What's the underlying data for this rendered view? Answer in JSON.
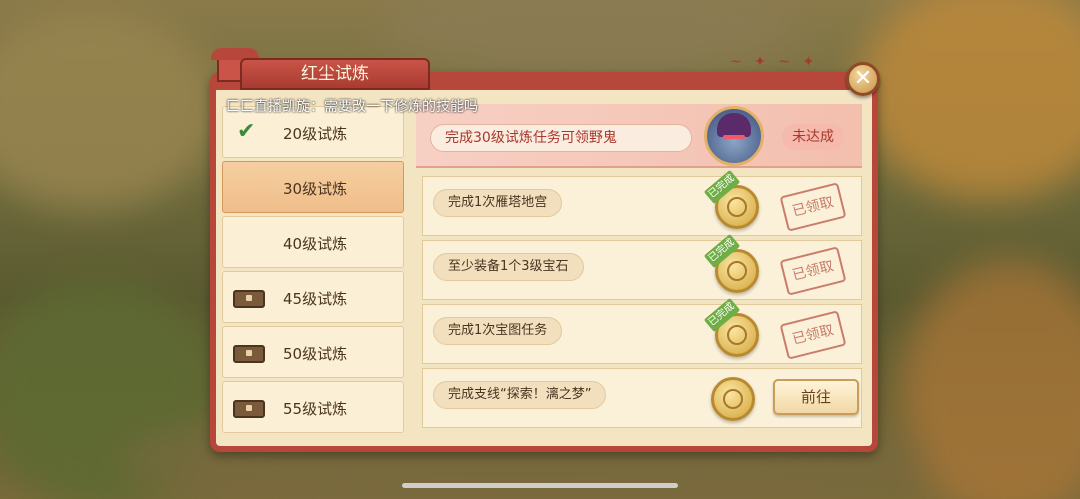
{
  "window": {
    "title": "红尘试炼",
    "close_label": "✕"
  },
  "overlay": {
    "chat_text": "匚匚直播凯旋：需要改一下修炼的技能吗"
  },
  "levels": [
    {
      "label": "20级试炼",
      "icon": "check-icon",
      "state": "completed"
    },
    {
      "label": "30级试炼",
      "icon": "",
      "state": "selected"
    },
    {
      "label": "40级试炼",
      "icon": "",
      "state": "normal"
    },
    {
      "label": "45级试炼",
      "icon": "chest-icon",
      "state": "normal"
    },
    {
      "label": "50级试炼",
      "icon": "chest-icon",
      "state": "normal"
    },
    {
      "label": "55级试炼",
      "icon": "chest-icon",
      "state": "normal"
    }
  ],
  "header": {
    "reward_text": "完成30级试炼任务可领野鬼",
    "status": "未达成",
    "avatar_icon": "ghost-avatar-icon"
  },
  "tasks": [
    {
      "text": "完成1次雁塔地宫",
      "tag": "已完成",
      "action": "已领取",
      "reward_icon": "coin-icon"
    },
    {
      "text": "至少装备1个3级宝石",
      "tag": "已完成",
      "action": "已领取",
      "reward_icon": "coin-icon"
    },
    {
      "text": "完成1次宝图任务",
      "tag": "已完成",
      "action": "已领取",
      "reward_icon": "coin-icon"
    },
    {
      "text": "完成支线“探索！漓之梦”",
      "tag": "",
      "action": "前往",
      "reward_icon": "coin-icon"
    }
  ],
  "colors": {
    "frame": "#b8473b",
    "panel_bg": "#f3e4c2",
    "selected_row": "#efbe8a",
    "done_green": "#6fae46"
  }
}
